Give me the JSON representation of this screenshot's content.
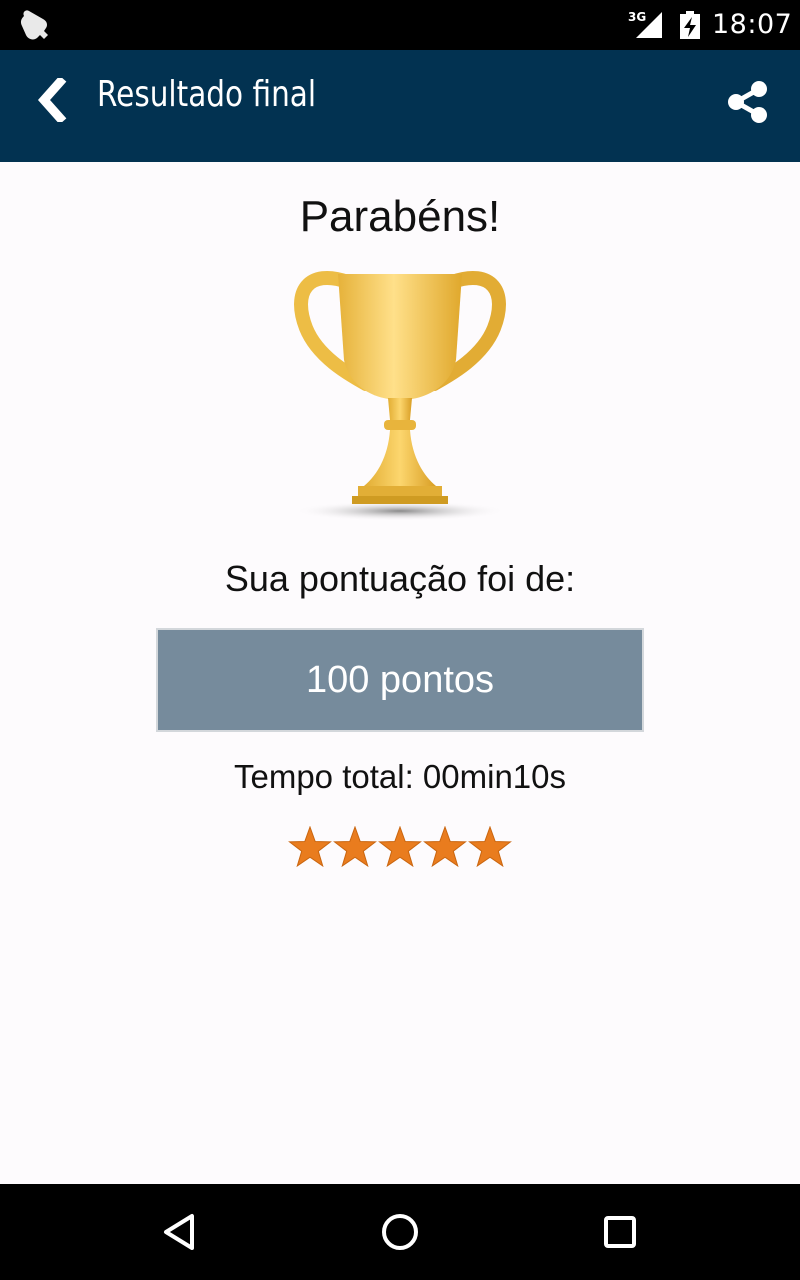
{
  "status_bar": {
    "network": "3G",
    "time": "18:07",
    "icons": [
      "notification-bell-icon",
      "signal-icon",
      "battery-charging-icon"
    ]
  },
  "app_bar": {
    "title": "Resultado final",
    "back_icon": "chevron-left-icon",
    "share_icon": "share-icon",
    "background": "#023251"
  },
  "result": {
    "heading": "Parabéns!",
    "trophy_icon": "trophy-icon",
    "score_label": "Sua pontuação foi de:",
    "score_value": "100 pontos",
    "score_box_color": "#768b9c",
    "total_time": "Tempo total: 00min10s",
    "rating": {
      "stars_filled": 5,
      "stars_total": 5,
      "star_color": "#e97c1e"
    }
  },
  "nav_bar": {
    "buttons": [
      "back-triangle-icon",
      "home-circle-icon",
      "recents-square-icon"
    ]
  }
}
